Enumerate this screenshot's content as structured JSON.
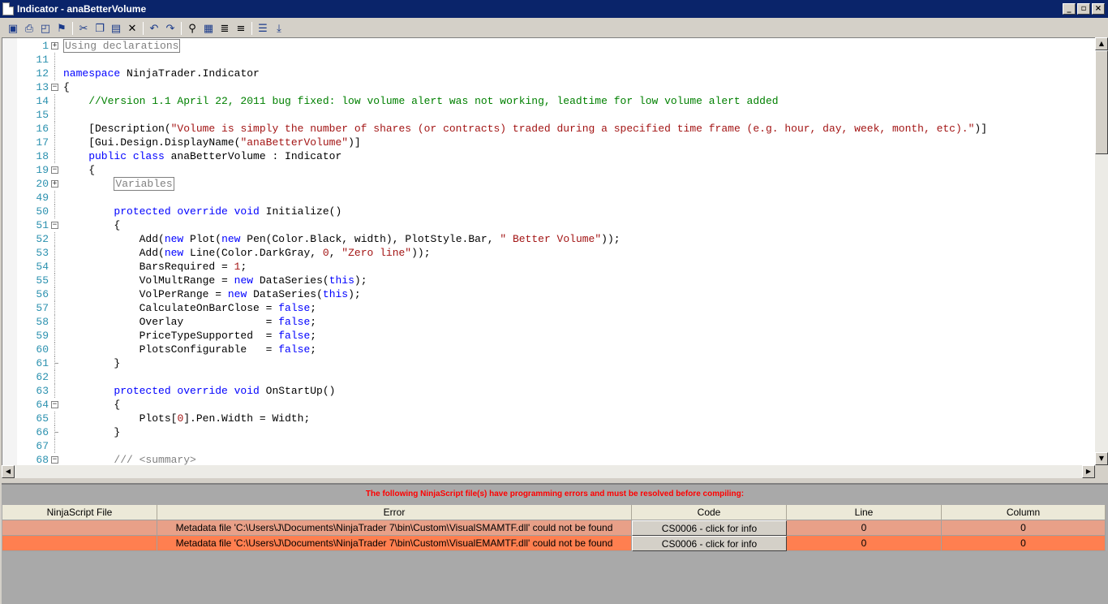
{
  "window": {
    "title": "Indicator - anaBetterVolume",
    "caption_buttons": [
      "_",
      "▫",
      "×"
    ]
  },
  "toolbar": {
    "icons": [
      "save-icon",
      "print-icon",
      "print-preview-icon",
      "compile-icon",
      "cut-icon",
      "copy-icon",
      "paste-icon",
      "delete-icon",
      "undo-icon",
      "redo-icon",
      "find-icon",
      "replace-icon",
      "indent-icon",
      "outdent-icon",
      "comment-icon",
      "uncomment-icon"
    ]
  },
  "code": [
    {
      "n": "1",
      "fold": "plus",
      "parts": [
        {
          "t": "Using declarations",
          "c": "region"
        }
      ]
    },
    {
      "n": "11",
      "parts": []
    },
    {
      "n": "12",
      "parts": [
        {
          "t": "namespace ",
          "c": "kw"
        },
        {
          "t": "NinjaTrader.Indicator",
          "c": ""
        }
      ]
    },
    {
      "n": "13",
      "fold": "minus",
      "parts": [
        {
          "t": "{",
          "c": ""
        }
      ]
    },
    {
      "n": "14",
      "parts": [
        {
          "t": "    //Version 1.1 April 22, 2011 bug fixed: low volume alert was not working, leadtime for low volume alert added",
          "c": "cm"
        }
      ]
    },
    {
      "n": "15",
      "parts": []
    },
    {
      "n": "16",
      "parts": [
        {
          "t": "    [Description(",
          "c": ""
        },
        {
          "t": "\"Volume is simply the number of shares (or contracts) traded during a specified time frame (e.g. hour, day, week, month, etc).\"",
          "c": "str"
        },
        {
          "t": ")]",
          "c": ""
        }
      ]
    },
    {
      "n": "17",
      "parts": [
        {
          "t": "    [Gui.Design.DisplayName(",
          "c": ""
        },
        {
          "t": "\"anaBetterVolume\"",
          "c": "str"
        },
        {
          "t": ")]",
          "c": ""
        }
      ]
    },
    {
      "n": "18",
      "parts": [
        {
          "t": "    public class ",
          "c": "kw"
        },
        {
          "t": "anaBetterVolume : Indicator",
          "c": ""
        }
      ]
    },
    {
      "n": "19",
      "fold": "minus",
      "parts": [
        {
          "t": "    {",
          "c": ""
        }
      ]
    },
    {
      "n": "20",
      "fold": "plus",
      "parts": [
        {
          "t": "        ",
          "c": ""
        },
        {
          "t": "Variables",
          "c": "region"
        }
      ]
    },
    {
      "n": "49",
      "parts": []
    },
    {
      "n": "50",
      "parts": [
        {
          "t": "        protected override void ",
          "c": "kw"
        },
        {
          "t": "Initialize()",
          "c": ""
        }
      ]
    },
    {
      "n": "51",
      "fold": "minus",
      "parts": [
        {
          "t": "        {",
          "c": ""
        }
      ]
    },
    {
      "n": "52",
      "parts": [
        {
          "t": "            Add(",
          "c": ""
        },
        {
          "t": "new ",
          "c": "kw"
        },
        {
          "t": "Plot(",
          "c": ""
        },
        {
          "t": "new ",
          "c": "kw"
        },
        {
          "t": "Pen(Color.Black, width), PlotStyle.Bar, ",
          "c": ""
        },
        {
          "t": "\" Better Volume\"",
          "c": "str"
        },
        {
          "t": "));",
          "c": ""
        }
      ]
    },
    {
      "n": "53",
      "parts": [
        {
          "t": "            Add(",
          "c": ""
        },
        {
          "t": "new ",
          "c": "kw"
        },
        {
          "t": "Line(Color.DarkGray, ",
          "c": ""
        },
        {
          "t": "0",
          "c": "str"
        },
        {
          "t": ", ",
          "c": ""
        },
        {
          "t": "\"Zero line\"",
          "c": "str"
        },
        {
          "t": "));",
          "c": ""
        }
      ]
    },
    {
      "n": "54",
      "parts": [
        {
          "t": "            BarsRequired = ",
          "c": ""
        },
        {
          "t": "1",
          "c": "str"
        },
        {
          "t": ";",
          "c": ""
        }
      ]
    },
    {
      "n": "55",
      "parts": [
        {
          "t": "            VolMultRange = ",
          "c": ""
        },
        {
          "t": "new ",
          "c": "kw"
        },
        {
          "t": "DataSeries(",
          "c": ""
        },
        {
          "t": "this",
          "c": "kw"
        },
        {
          "t": ");",
          "c": ""
        }
      ]
    },
    {
      "n": "56",
      "parts": [
        {
          "t": "            VolPerRange = ",
          "c": ""
        },
        {
          "t": "new ",
          "c": "kw"
        },
        {
          "t": "DataSeries(",
          "c": ""
        },
        {
          "t": "this",
          "c": "kw"
        },
        {
          "t": ");",
          "c": ""
        }
      ]
    },
    {
      "n": "57",
      "parts": [
        {
          "t": "            CalculateOnBarClose = ",
          "c": ""
        },
        {
          "t": "false",
          "c": "kw"
        },
        {
          "t": ";",
          "c": ""
        }
      ]
    },
    {
      "n": "58",
      "parts": [
        {
          "t": "            Overlay             = ",
          "c": ""
        },
        {
          "t": "false",
          "c": "kw"
        },
        {
          "t": ";",
          "c": ""
        }
      ]
    },
    {
      "n": "59",
      "parts": [
        {
          "t": "            PriceTypeSupported  = ",
          "c": ""
        },
        {
          "t": "false",
          "c": "kw"
        },
        {
          "t": ";",
          "c": ""
        }
      ]
    },
    {
      "n": "60",
      "parts": [
        {
          "t": "            PlotsConfigurable   = ",
          "c": ""
        },
        {
          "t": "false",
          "c": "kw"
        },
        {
          "t": ";",
          "c": ""
        }
      ]
    },
    {
      "n": "61",
      "fold": "end",
      "parts": [
        {
          "t": "        }",
          "c": ""
        }
      ]
    },
    {
      "n": "62",
      "parts": []
    },
    {
      "n": "63",
      "parts": [
        {
          "t": "        protected override void ",
          "c": "kw"
        },
        {
          "t": "OnStartUp()",
          "c": ""
        }
      ]
    },
    {
      "n": "64",
      "fold": "minus",
      "parts": [
        {
          "t": "        {",
          "c": ""
        }
      ]
    },
    {
      "n": "65",
      "parts": [
        {
          "t": "            Plots[",
          "c": ""
        },
        {
          "t": "0",
          "c": "str"
        },
        {
          "t": "].Pen.Width = Width;",
          "c": ""
        }
      ]
    },
    {
      "n": "66",
      "fold": "end",
      "parts": [
        {
          "t": "        }",
          "c": ""
        }
      ]
    },
    {
      "n": "67",
      "parts": []
    },
    {
      "n": "68",
      "fold": "minus",
      "parts": [
        {
          "t": "        /// <summary>",
          "c": "gr"
        }
      ]
    }
  ],
  "errors": {
    "message": "The following NinjaScript file(s) have programming errors and must be resolved before compiling:",
    "columns": [
      "NinjaScript File",
      "Error",
      "Code",
      "Line",
      "Column"
    ],
    "rows": [
      {
        "file": "",
        "error": "Metadata file 'C:\\Users\\J\\Documents\\NinjaTrader 7\\bin\\Custom\\VisualSMAMTF.dll' could not be found",
        "code": "CS0006 - click for info",
        "line": "0",
        "column": "0",
        "bg": "#e8a088"
      },
      {
        "file": "",
        "error": "Metadata file 'C:\\Users\\J\\Documents\\NinjaTrader 7\\bin\\Custom\\VisualEMAMTF.dll' could not be found",
        "code": "CS0006 - click for info",
        "line": "0",
        "column": "0",
        "bg": "#ff7f50"
      }
    ]
  }
}
